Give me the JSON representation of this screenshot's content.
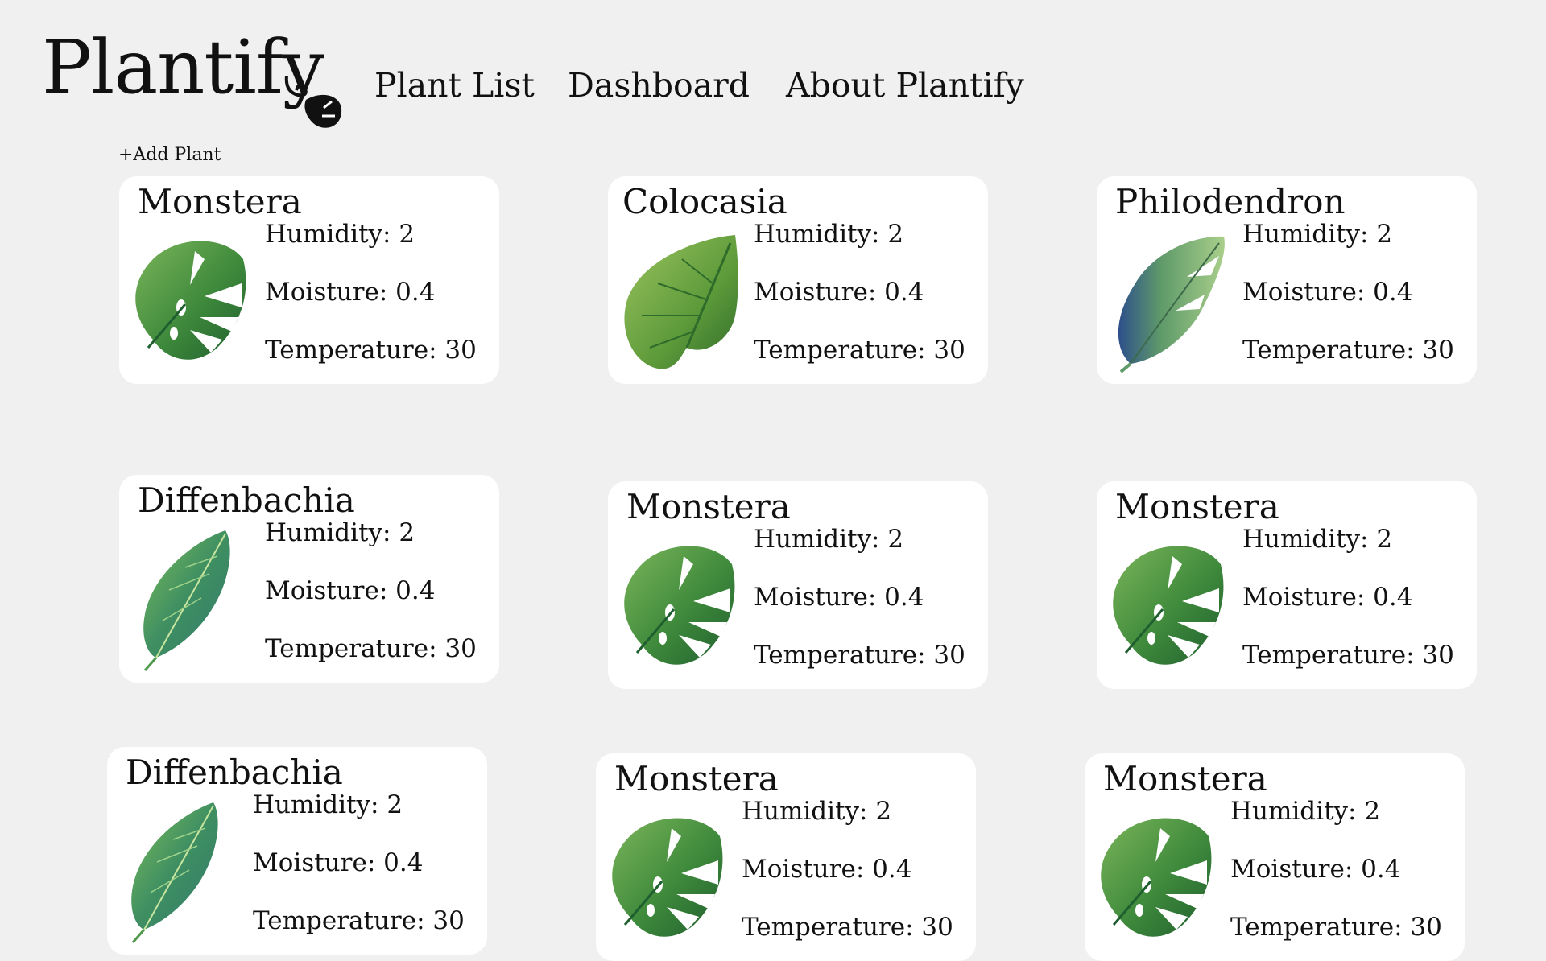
{
  "app": {
    "logo_text": "Plantify"
  },
  "nav": {
    "plant_list": "Plant List",
    "dashboard": "Dashboard",
    "about": "About Plantify"
  },
  "actions": {
    "add_plant": "+Add Plant"
  },
  "colors": {
    "background": "#f0f0f0",
    "card": "#ffffff",
    "text": "#111111",
    "leaf_dark": "#1f5e2e",
    "leaf_mid": "#3f8a3c",
    "leaf_light": "#7bb55a",
    "leaf_teal": "#2f7a6a",
    "leaf_blue": "#2d4f8a"
  },
  "plants": [
    {
      "name": "Monstera",
      "icon": "monstera-leaf-icon",
      "humidity": "Humidity: 2",
      "moisture": "Moisture: 0.4",
      "temperature": "Temperature: 30"
    },
    {
      "name": "Colocasia",
      "icon": "colocasia-leaf-icon",
      "humidity": "Humidity: 2",
      "moisture": "Moisture: 0.4",
      "temperature": "Temperature: 30"
    },
    {
      "name": "Philodendron",
      "icon": "philodendron-leaf-icon",
      "humidity": "Humidity: 2",
      "moisture": "Moisture: 0.4",
      "temperature": "Temperature: 30"
    },
    {
      "name": "Diffenbachia",
      "icon": "diffenbachia-leaf-icon",
      "humidity": "Humidity: 2",
      "moisture": "Moisture: 0.4",
      "temperature": "Temperature: 30"
    },
    {
      "name": "Monstera",
      "icon": "monstera-leaf-icon",
      "humidity": "Humidity: 2",
      "moisture": "Moisture: 0.4",
      "temperature": "Temperature: 30"
    },
    {
      "name": "Monstera",
      "icon": "monstera-leaf-icon",
      "humidity": "Humidity: 2",
      "moisture": "Moisture: 0.4",
      "temperature": "Temperature: 30"
    },
    {
      "name": "Diffenbachia",
      "icon": "diffenbachia-leaf-icon",
      "humidity": "Humidity: 2",
      "moisture": "Moisture: 0.4",
      "temperature": "Temperature: 30"
    },
    {
      "name": "Monstera",
      "icon": "monstera-leaf-icon",
      "humidity": "Humidity: 2",
      "moisture": "Moisture: 0.4",
      "temperature": "Temperature: 30"
    },
    {
      "name": "Monstera",
      "icon": "monstera-leaf-icon",
      "humidity": "Humidity: 2",
      "moisture": "Moisture: 0.4",
      "temperature": "Temperature: 30"
    }
  ]
}
